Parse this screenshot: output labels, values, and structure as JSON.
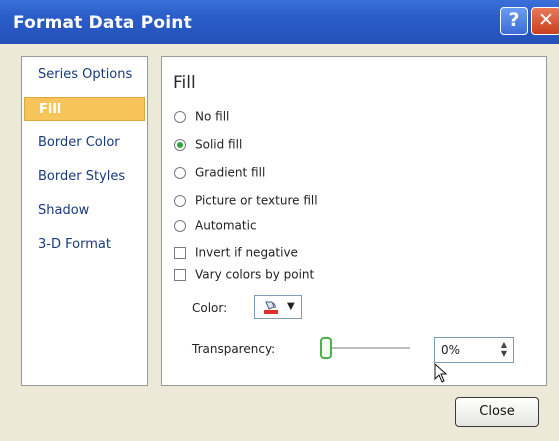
{
  "window": {
    "title": "Format Data Point",
    "help_label": "?",
    "close_glyph": "✕"
  },
  "sidebar": {
    "items": [
      {
        "label": "Series Options",
        "selected": false
      },
      {
        "label": "Fill",
        "selected": true
      },
      {
        "label": "Border Color",
        "selected": false
      },
      {
        "label": "Border Styles",
        "selected": false
      },
      {
        "label": "Shadow",
        "selected": false
      },
      {
        "label": "3-D Format",
        "selected": false
      }
    ]
  },
  "panel": {
    "title": "Fill",
    "fill_options": [
      {
        "label": "No fill",
        "checked": false
      },
      {
        "label": "Solid fill",
        "checked": true
      },
      {
        "label": "Gradient fill",
        "checked": false
      },
      {
        "label": "Picture or texture fill",
        "checked": false
      },
      {
        "label": "Automatic",
        "checked": false
      }
    ],
    "checkboxes": [
      {
        "label": "Invert if negative",
        "checked": false
      },
      {
        "label": "Vary colors by point",
        "checked": false
      }
    ],
    "color_label": "Color:",
    "transparency_label": "Transparency:",
    "transparency_value": "0%",
    "transparency_level": 0
  },
  "footer": {
    "close_label": "Close"
  },
  "colors": {
    "titlebar": "#2451b8",
    "selected_item": "#f7c45c",
    "radio_checked": "#2aa83a",
    "fill_color_swatch": "#d9342b"
  },
  "icons": {
    "paint_bucket": "paint-bucket-icon",
    "dropdown": "chevron-down-icon",
    "spin": "spin-arrows-icon",
    "cursor": "mouse-cursor-icon"
  }
}
